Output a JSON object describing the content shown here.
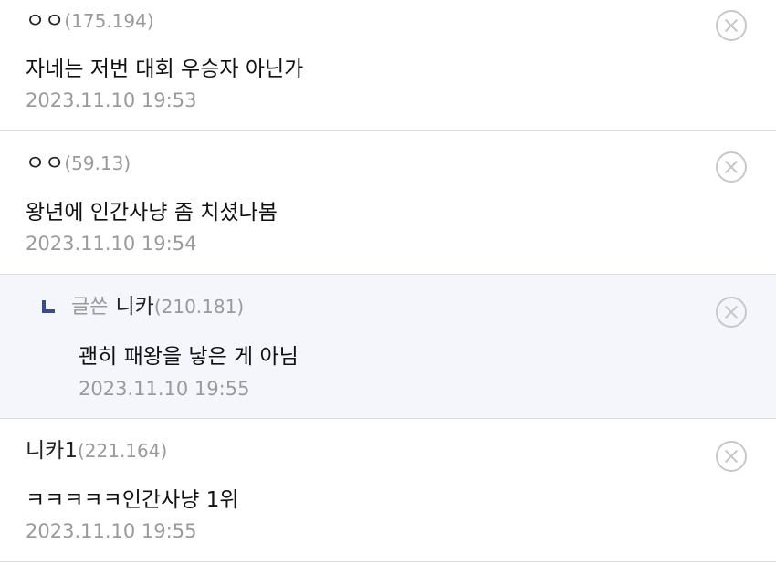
{
  "comments": [
    {
      "nick": "ㅇㅇ",
      "ip": "(175.194)",
      "text": "자네는 저번 대회 우승자 아닌가",
      "date": "2023.11.10 19:53",
      "delete_icon": "close-circle-icon"
    },
    {
      "nick": "ㅇㅇ",
      "ip": "(59.13)",
      "text": "왕년에 인간사냥 좀 치셨나봄",
      "date": "2023.11.10 19:54",
      "delete_icon": "close-circle-icon"
    },
    {
      "reply_icon": "reply-arrow-icon",
      "written_by": "글쓴",
      "nick": "니카",
      "ip": "(210.181)",
      "text": "괜히 패왕을 낳은 게 아님",
      "date": "2023.11.10 19:55",
      "delete_icon": "close-circle-icon"
    },
    {
      "nick": "니카1",
      "ip": "(221.164)",
      "text": "ㅋㅋㅋㅋㅋ인간사냥 1위",
      "date": "2023.11.10 19:55",
      "delete_icon": "close-circle-icon"
    }
  ],
  "colors": {
    "reply_bg": "#f4f6fb",
    "reply_arrow": "#3b4a8c",
    "meta_gray": "#9a9a9a"
  }
}
